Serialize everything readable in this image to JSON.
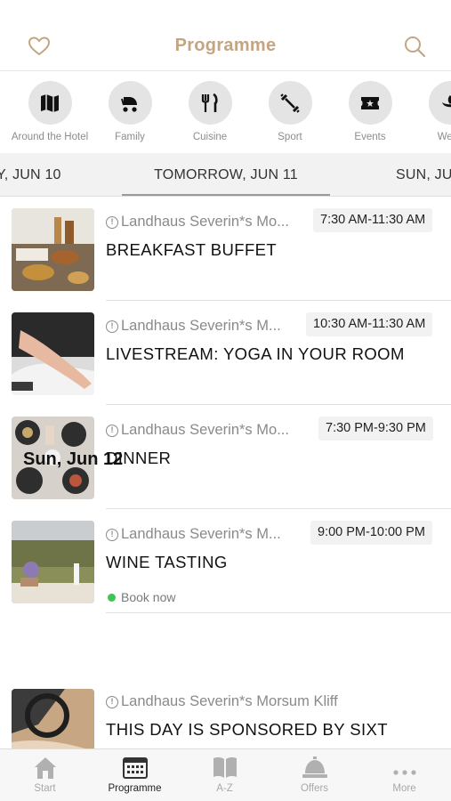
{
  "header": {
    "title": "Programme"
  },
  "categories": [
    {
      "label": "Around the Hotel",
      "icon": "map-icon"
    },
    {
      "label": "Family",
      "icon": "stroller-icon"
    },
    {
      "label": "Cuisine",
      "icon": "cutlery-icon"
    },
    {
      "label": "Sport",
      "icon": "dumbbell-icon"
    },
    {
      "label": "Events",
      "icon": "ticket-icon"
    },
    {
      "label": "Welln",
      "icon": "wellness-icon"
    }
  ],
  "day_tabs": {
    "prev": "Y, JUN 10",
    "active": "TOMORROW, JUN 11",
    "next": "SUN, JU"
  },
  "events": [
    {
      "venue": "Landhaus Severin*s Mo...",
      "time": "7:30 AM-11:30 AM",
      "name": "BREAKFAST BUFFET"
    },
    {
      "venue": "Landhaus Severin*s M...",
      "time": "10:30 AM-11:30 AM",
      "name": "LIVESTREAM: YOGA IN YOUR ROOM"
    },
    {
      "venue": "Landhaus Severin*s Mo...",
      "time": "7:30 PM-9:30 PM",
      "name": "DINNER"
    },
    {
      "venue": "Landhaus Severin*s M...",
      "time": "9:00 PM-10:00 PM",
      "name": "WINE TASTING",
      "book": "Book now"
    }
  ],
  "day_header": "Sun, Jun 12",
  "next_day_events": [
    {
      "venue": "Landhaus Severin*s Morsum Kliff",
      "name": "THIS DAY IS SPONSORED BY SIXT"
    }
  ],
  "tabbar": [
    {
      "label": "Start",
      "icon": "home-icon"
    },
    {
      "label": "Programme",
      "icon": "calendar-icon",
      "active": true
    },
    {
      "label": "A-Z",
      "icon": "book-icon"
    },
    {
      "label": "Offers",
      "icon": "service-bell-icon"
    },
    {
      "label": "More",
      "icon": "more-dots-icon"
    }
  ],
  "colors": {
    "accent": "#c4a583",
    "book_dot": "#3cc84c"
  }
}
